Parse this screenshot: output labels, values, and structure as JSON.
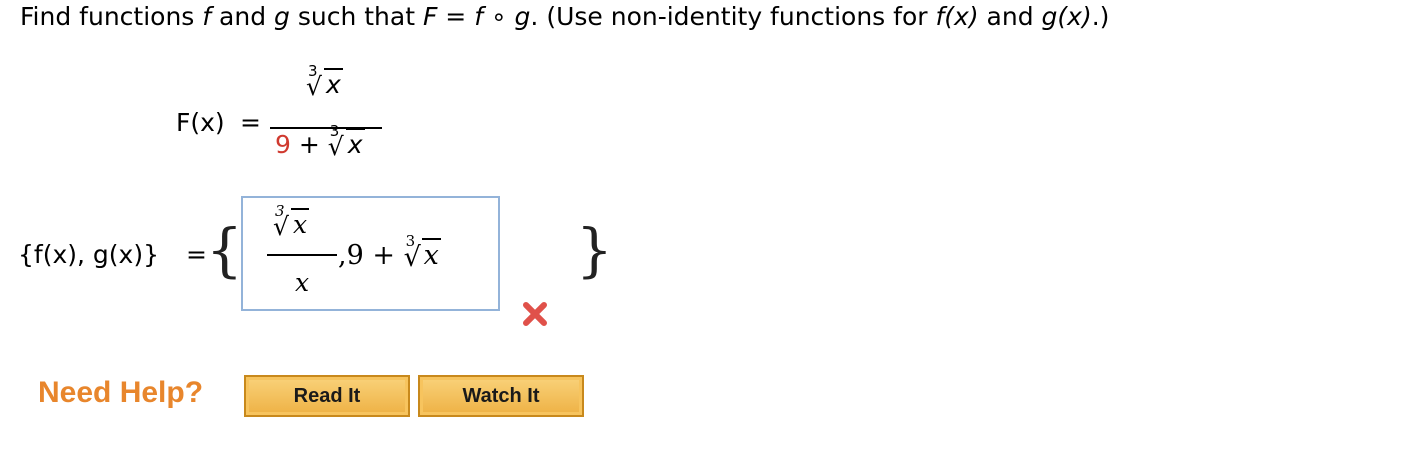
{
  "question": {
    "prefix": "Find functions ",
    "f": "f",
    "and": " and ",
    "g": "g",
    "such_that": " such that ",
    "F": "F",
    "eq": " = ",
    "compose": "f ∘ g",
    "suffix": ". (Use non-identity functions for ",
    "fx": "f(x)",
    "and2": " and ",
    "gx": "g(x)",
    "end": ".)"
  },
  "function_display": {
    "label": "F(x)",
    "equals": "=",
    "numerator_index": "3",
    "numerator_radicand": "x",
    "denominator_constant": "9",
    "denominator_plus": " + ",
    "denominator_index": "3",
    "denominator_radicand": "x"
  },
  "answer": {
    "label": "{f(x), g(x)}",
    "equals": "=",
    "open_brace": "{",
    "close_brace": "}",
    "numerator_index": "3",
    "numerator_radicand": "x",
    "denominator": "x",
    "rest_prefix": ",9 + ",
    "rest_index": "3",
    "rest_radicand": "x",
    "status": "incorrect",
    "status_color": "#e0514a"
  },
  "help": {
    "label": "Need Help?",
    "read_button": "Read It",
    "watch_button": "Watch It",
    "accent": "#e8862c"
  }
}
